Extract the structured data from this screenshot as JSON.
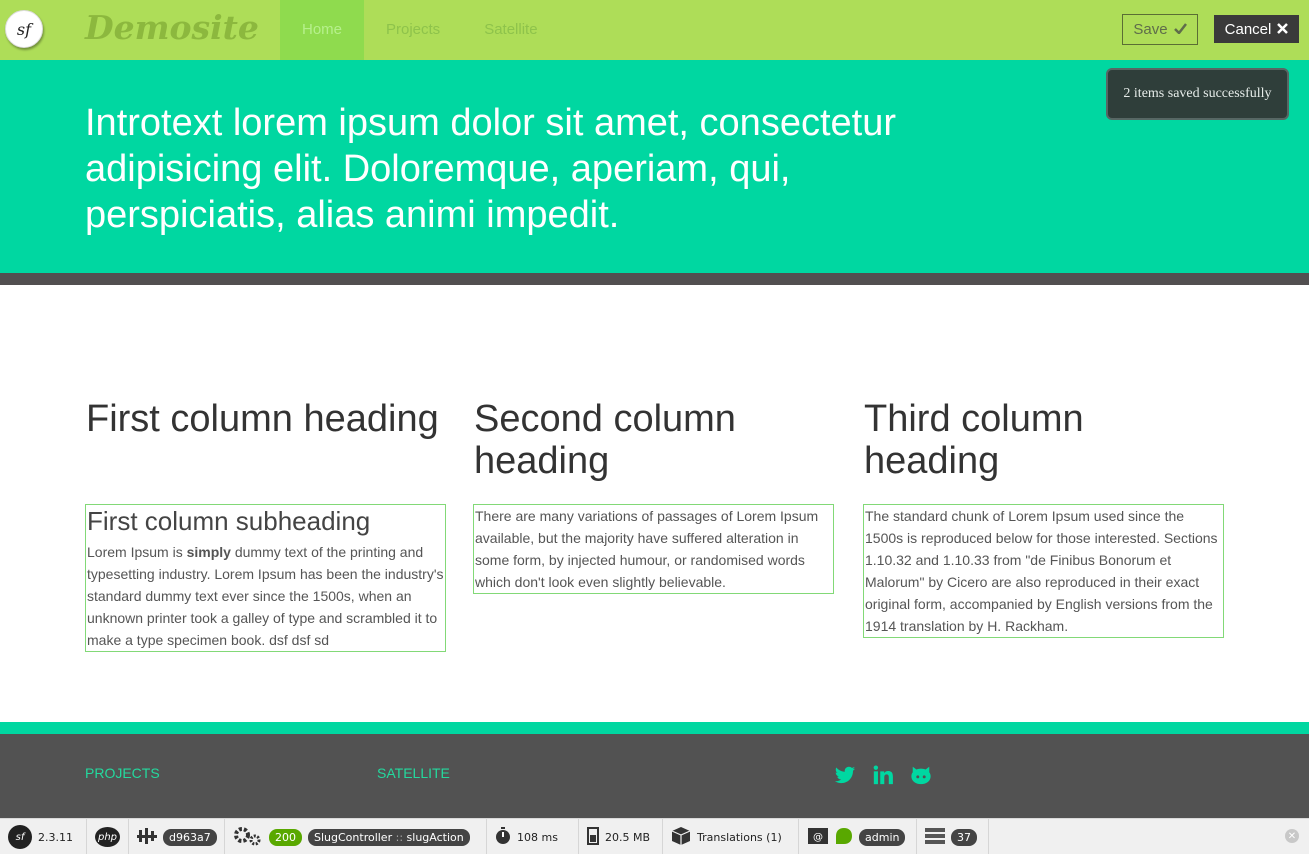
{
  "header": {
    "logo_text": "sf",
    "brand": "Demosite",
    "nav": [
      {
        "label": "Home",
        "active": true
      },
      {
        "label": "Projects",
        "active": false
      },
      {
        "label": "Satellite",
        "active": false
      }
    ],
    "save_label": "Save",
    "cancel_label": "Cancel"
  },
  "toast": {
    "message": "2 items saved successfully"
  },
  "hero": {
    "text": "Introtext lorem ipsum dolor sit amet, consectetur adipisicing elit. Doloremque, aperiam, qui, perspiciatis, alias animi impedit."
  },
  "columns": [
    {
      "heading": "First column heading",
      "subheading": "First column subheading",
      "body_before": "Lorem Ipsum is ",
      "body_bold": "simply",
      "body_after": " dummy text of the printing and typesetting industry. Lorem Ipsum has been the industry's standard dummy text ever since the 1500s, when an unknown printer took a galley of type and scrambled it to make a type specimen book. dsf dsf sd"
    },
    {
      "heading": "Second column heading",
      "body": "There are many variations of passages of Lorem Ipsum available, but the majority have suffered alteration in some form, by injected humour, or randomised words which don't look even slightly believable."
    },
    {
      "heading": "Third column heading",
      "body": "The standard chunk of Lorem Ipsum used since the 1500s is reproduced below for those interested. Sections 1.10.32 and 1.10.33 from \"de Finibus Bonorum et Malorum\" by Cicero are also reproduced in their exact original form, accompanied by English versions from the 1914 translation by H. Rackham."
    }
  ],
  "footer": {
    "links": [
      "PROJECTS",
      "SATELLITE"
    ],
    "social": [
      "twitter-icon",
      "linkedin-icon",
      "github-icon"
    ],
    "accent": "#00d7a1"
  },
  "debug_toolbar": {
    "sf_version": "2.3.11",
    "php_label": "php",
    "token": "d963a7",
    "status": "200",
    "controller": "SlugController",
    "separator": "::",
    "action": "slugAction",
    "time": "108 ms",
    "memory": "20.5 MB",
    "translations": "Translations (1)",
    "user": "admin",
    "queries": "37"
  },
  "colors": {
    "topbar": "#aedd58",
    "hero": "#00d7a1",
    "footer": "#525252",
    "nav_active": "#8fdb4e"
  }
}
